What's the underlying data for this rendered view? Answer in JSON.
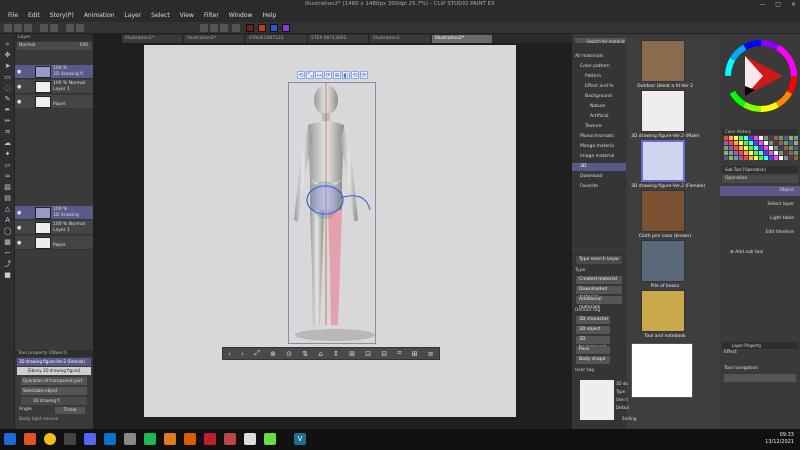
{
  "window": {
    "title": "Illustration2* (1480 x 1480px 300dpi 25.7%)  - CLIP STUDIO PAINT EX",
    "controls": [
      "—",
      "□",
      "✕"
    ]
  },
  "menu": [
    "File",
    "Edit",
    "Story(P)",
    "Animation",
    "Layer",
    "Select",
    "View",
    "Filter",
    "Window",
    "Help"
  ],
  "tabs": [
    "Illustration1*",
    "Illustration2*",
    "STAGE1187122",
    "STEP 08713022",
    "Illustration1",
    "Illustration2*"
  ],
  "active_tab_index": 5,
  "colors": {
    "swatches": [
      "#6b1f1f",
      "#c0392b",
      "#3456d6",
      "#8a3be0"
    ],
    "accent": "#5a5a8a"
  },
  "layers_top": {
    "header": "Layer",
    "blend_label": "Normal",
    "opacity": "100",
    "items": [
      {
        "meta": "100 %",
        "name": "3D drawing fi"
      },
      {
        "meta": "100 % Normal",
        "name": "Layer 1"
      },
      {
        "meta": "",
        "name": "Paper"
      }
    ]
  },
  "layers_bottom": {
    "items": [
      {
        "meta": "100 %",
        "name": "3D drawing"
      },
      {
        "meta": "100 % Normal",
        "name": "Layer 1"
      },
      {
        "meta": "",
        "name": "Paper"
      }
    ]
  },
  "tool_property": {
    "header": "Tool property [Object]",
    "object_name": "3D drawing figure-Ver.2 (Female)",
    "button": "[Ebony 3D drawing figure]",
    "operation": "Operation of transparent part",
    "select_label": "Selectable object",
    "layer_label": "3D drawing fi",
    "angle_label": "Angle",
    "angle_value": "Tinsel",
    "body_light": "Body light source"
  },
  "material_tree": {
    "search_placeholder": "Search for material in ...",
    "items": [
      {
        "label": "All materials",
        "indent": 0
      },
      {
        "label": "Color pattern",
        "indent": 1
      },
      {
        "label": "Pattern",
        "indent": 2
      },
      {
        "label": "Effect and fe",
        "indent": 2
      },
      {
        "label": "Background",
        "indent": 2
      },
      {
        "label": "Nature",
        "indent": 3
      },
      {
        "label": "Artificial",
        "indent": 3
      },
      {
        "label": "Texture",
        "indent": 2
      },
      {
        "label": "Monochromatic",
        "indent": 1
      },
      {
        "label": "Manga materia",
        "indent": 1
      },
      {
        "label": "Image material",
        "indent": 1
      },
      {
        "label": "3D",
        "indent": 1
      },
      {
        "label": "Download",
        "indent": 1
      },
      {
        "label": "Favorite",
        "indent": 1
      }
    ],
    "selected_index": 11
  },
  "tag_panel": {
    "search_placeholder": "Type search keyw",
    "type_label": "Type",
    "types": [
      "Created material",
      "Downloaded material",
      "Additional materials"
    ],
    "default_tag_label": "Default tag",
    "default_tags": [
      "3D character",
      "3D object",
      "3D background",
      "Pose",
      "Body shape"
    ],
    "user_tag_label": "User tag"
  },
  "materials": [
    {
      "caption": "Outdoor (bleat a fd-Ver 2",
      "kind": "building"
    },
    {
      "caption": "3D drawing figure-Ver.2 (Male)",
      "kind": "figure"
    },
    {
      "caption": "3D drawing figure-Ver.2 (Female)",
      "kind": "figure",
      "selected": true
    },
    {
      "caption": "Cloth pen case (brown)",
      "kind": "case"
    },
    {
      "caption": "Pile of books",
      "kind": "books"
    },
    {
      "caption": "Tool and notebook",
      "kind": "notebook"
    }
  ],
  "material_bottom": {
    "labels": [
      "3D do",
      "Type",
      "User t",
      "Defaul"
    ],
    "sort_label": "Sorting"
  },
  "color_history": {
    "header": "Color History"
  },
  "subtool": {
    "header": "Sub Tool [Operation]",
    "group": "Operation",
    "items": [
      "Object",
      "Select layer",
      "Light table",
      "Edit timeline"
    ],
    "add_label": "Add sub tool"
  },
  "layer_property": {
    "header": "Layer Property",
    "effect_label": "Effect",
    "tool_nav_label": "Tool navigation"
  },
  "figure_toolbar_icons": [
    "‹",
    "›",
    "⤢",
    "⊕",
    "⊙",
    "⇅",
    "⌂",
    "↕",
    "⊞",
    "⊡",
    "⊟",
    "⌗",
    "⊞",
    "≡"
  ],
  "figure_top_icons": [
    "⟲",
    "⤡",
    "↔",
    "⟳",
    "⊕",
    "◐",
    "⟲",
    "⟳"
  ],
  "clock": {
    "time": "09:33",
    "date": "13/12/2021"
  }
}
